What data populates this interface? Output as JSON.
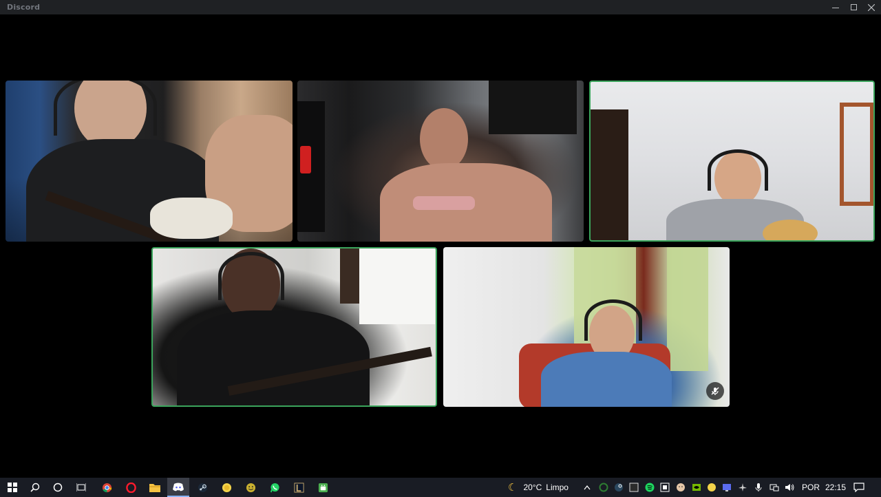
{
  "window": {
    "title": "Discord"
  },
  "taskbar": {
    "weather_temp": "20°C",
    "weather_desc": "Limpo",
    "language": "POR",
    "time": "22:15"
  },
  "colors": {
    "speaking_border": "#3ba55c",
    "titlebar_bg": "#1f2124",
    "taskbar_bg": "#191c24"
  }
}
